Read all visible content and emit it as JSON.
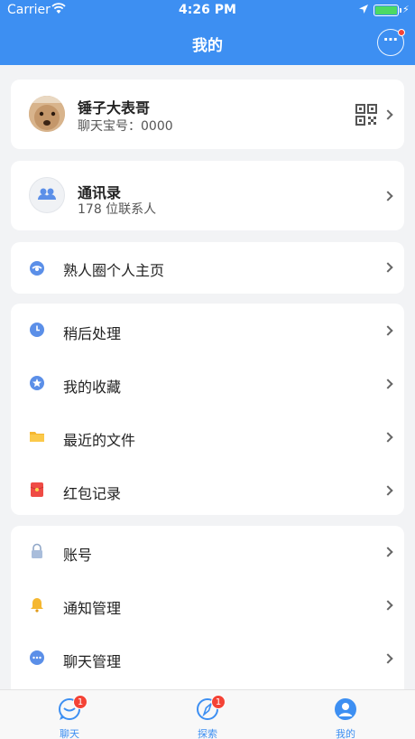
{
  "status_bar": {
    "carrier": "Carrier",
    "time": "4:26 PM"
  },
  "nav": {
    "title": "我的",
    "more_glyph": "⋯",
    "accent": "#3d8ff2"
  },
  "profile": {
    "name": "锤子大表哥",
    "id_text": "聊天宝号：0000"
  },
  "contacts": {
    "title": "通讯录",
    "count_text": "178 位联系人"
  },
  "moments": {
    "label": "熟人圈个人主页"
  },
  "group_tools": {
    "items": [
      {
        "label": "稍后处理",
        "icon": "clock-icon"
      },
      {
        "label": "我的收藏",
        "icon": "star-icon"
      },
      {
        "label": "最近的文件",
        "icon": "folder-icon"
      },
      {
        "label": "红包记录",
        "icon": "red-envelope-icon"
      }
    ]
  },
  "group_settings": {
    "items": [
      {
        "label": "账号",
        "icon": "lock-icon"
      },
      {
        "label": "通知管理",
        "icon": "bell-icon"
      },
      {
        "label": "聊天管理",
        "icon": "chat-icon"
      }
    ]
  },
  "tabbar": {
    "tabs": [
      {
        "label": "聊天",
        "badge": "1",
        "icon": "chat-tab-icon"
      },
      {
        "label": "探索",
        "badge": "1",
        "icon": "compass-icon"
      },
      {
        "label": "我的",
        "badge": "",
        "icon": "profile-icon"
      }
    ]
  }
}
